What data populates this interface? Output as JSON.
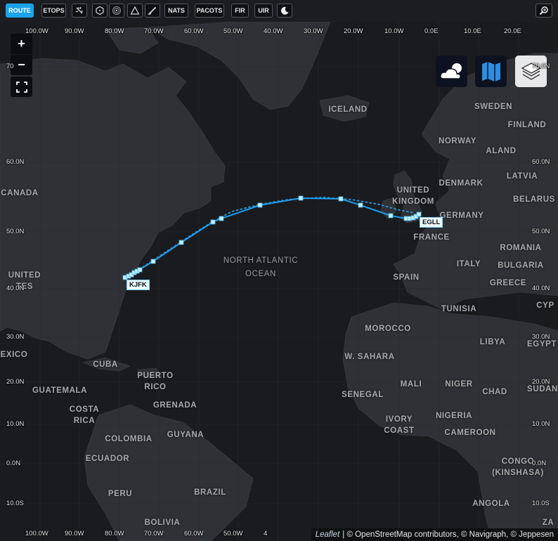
{
  "toolbar": {
    "route_label": "ROUTE",
    "etops_label": "ETOPS",
    "nats_label": "NATS",
    "pacots_label": "PACOTS",
    "fir_label": "FIR",
    "uir_label": "UIR",
    "icons": [
      "plane-icon",
      "hexagon-icon",
      "target-icon",
      "triangle-icon",
      "rocket-icon",
      "moon-icon",
      "zoom-search-icon"
    ]
  },
  "colors": {
    "accent": "#1aa3e8",
    "route": "#1e9cf0",
    "waypoint": "#bfefff",
    "land": "#303136",
    "water": "#1a1b1e"
  },
  "map": {
    "zoom_in_label": "+",
    "zoom_out_label": "−",
    "layer_buttons": [
      "weather-layer-icon",
      "map-layer-icon",
      "stack-layer-icon"
    ],
    "top_lon_labels": [
      "100.0W",
      "90.0W",
      "80.0W",
      "70.0W",
      "60.0W",
      "50.0W",
      "40.0W",
      "30.0W",
      "20.0W",
      "10.0W",
      "0.0E",
      "10.0E",
      "20.0E"
    ],
    "bottom_lon_labels": [
      "100.0W",
      "90.0W",
      "80.0W",
      "70.0W",
      "60.0W",
      "50.0W",
      "4"
    ],
    "left_lat_labels": [
      "70",
      "60.0N",
      "50.0N",
      "40.0N",
      "30.0N",
      "20.0N",
      "10.0N",
      "0.0N",
      "10.0S"
    ],
    "right_lat_labels": [
      "70.0N",
      "60.0N",
      "50.0N",
      "40.0N",
      "30.0N",
      "20.0N",
      "10.0N",
      "0.0N",
      "10.0S"
    ],
    "countries": [
      "ICELAND",
      "SWEDEN",
      "FINLAND",
      "NORWAY",
      "ALAND",
      "LATVIA",
      "DENMARK",
      "UNITED KINGDOM",
      "BELARUS",
      "GERMANY",
      "FRANCE",
      "ROMANIA",
      "ITALY",
      "BULGARIA",
      "SPAIN",
      "GREECE",
      "CYP",
      "TUNISIA",
      "MOROCCO",
      "LIBYA",
      "EGYPT",
      "W. SAHARA",
      "MALI",
      "NIGER",
      "CHAD",
      "SUDAN",
      "SENEGAL",
      "NIGERIA",
      "IVORY COAST",
      "CAMEROON",
      "CONGO (KINSHASA)",
      "ANGOLA",
      "ZA",
      "CANADA",
      "UNITED TES",
      "EXICO",
      "CUBA",
      "PUERTO RICO",
      "GUATEMALA",
      "COSTA RICA",
      "GRENADA",
      "GUYANA",
      "COLOMBIA",
      "ECUADOR",
      "PERU",
      "BRAZIL",
      "BOLIVIA"
    ],
    "ocean": "NORTH ATLANTIC OCEAN",
    "origin": "KJFK",
    "destination": "EGLL",
    "attribution_brand": "Leaflet",
    "attribution_text": "| © OpenStreetMap contributors, © Navigraph, © Jeppesen"
  }
}
